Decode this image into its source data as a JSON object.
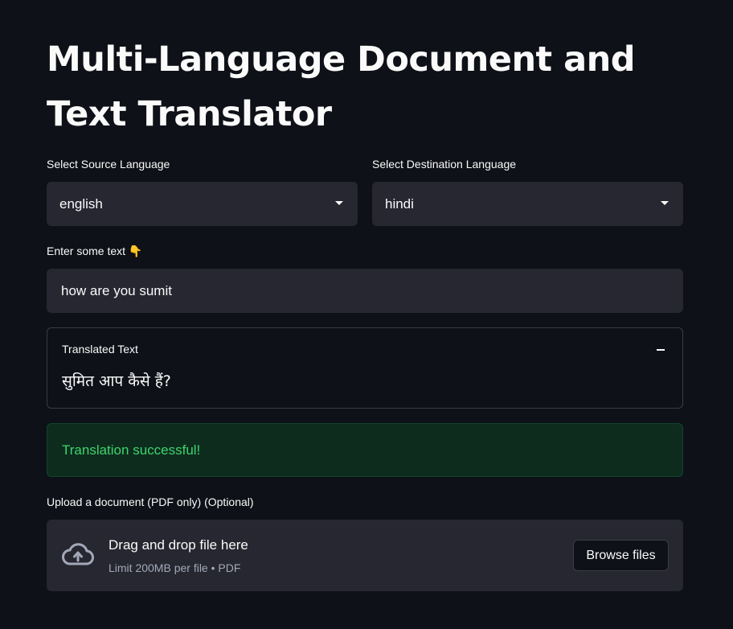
{
  "page": {
    "title": "Multi-Language Document and Text Translator"
  },
  "source_language": {
    "label": "Select Source Language",
    "selected": "english"
  },
  "destination_language": {
    "label": "Select Destination Language",
    "selected": "hindi"
  },
  "text_input": {
    "label": "Enter some text 👇",
    "value": "how are you sumit"
  },
  "translation": {
    "title": "Translated Text",
    "result": "सुमित आप कैसे हैं?"
  },
  "status": {
    "message": "Translation successful!"
  },
  "uploader": {
    "label": "Upload a document (PDF only) (Optional)",
    "drop_text": "Drag and drop file here",
    "limit_text": "Limit 200MB per file • PDF",
    "browse_label": "Browse files"
  },
  "colors": {
    "background": "#0e1117",
    "widget_bg": "#262730",
    "success_bg": "#0e2c1e",
    "success_text": "#3dd56d"
  },
  "icons": [
    "chevron-down-icon",
    "collapse-icon",
    "cloud-upload-icon"
  ]
}
